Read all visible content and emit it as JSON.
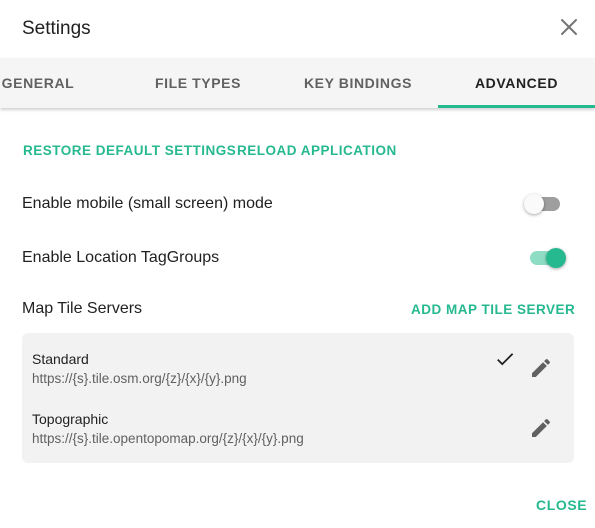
{
  "dialog": {
    "title": "Settings"
  },
  "tabs": [
    {
      "label": "GENERAL",
      "active": false
    },
    {
      "label": "FILE TYPES",
      "active": false
    },
    {
      "label": "KEY BINDINGS",
      "active": false
    },
    {
      "label": "ADVANCED",
      "active": true
    }
  ],
  "actions": {
    "restore_label": "RESTORE DEFAULT SETTINGS",
    "reload_label": "RELOAD APPLICATION"
  },
  "settings": {
    "mobile_mode": {
      "label": "Enable mobile (small screen) mode",
      "enabled": false
    },
    "location_taggroups": {
      "label": "Enable Location TagGroups",
      "enabled": true
    }
  },
  "map_tile_servers": {
    "heading": "Map Tile Servers",
    "add_label": "ADD MAP TILE SERVER",
    "servers": [
      {
        "name": "Standard",
        "url": "https://{s}.tile.osm.org/{z}/{x}/{y}.png",
        "selected": true
      },
      {
        "name": "Topographic",
        "url": "https://{s}.tile.opentopomap.org/{z}/{x}/{y}.png",
        "selected": false
      }
    ]
  },
  "footer": {
    "close_label": "CLOSE"
  },
  "colors": {
    "accent": "#26b98f",
    "tab_bg": "#f5f5f5",
    "list_bg": "#f2f2f2"
  },
  "icons": {
    "close": "close-icon",
    "check": "check-icon",
    "edit": "pencil-icon"
  }
}
